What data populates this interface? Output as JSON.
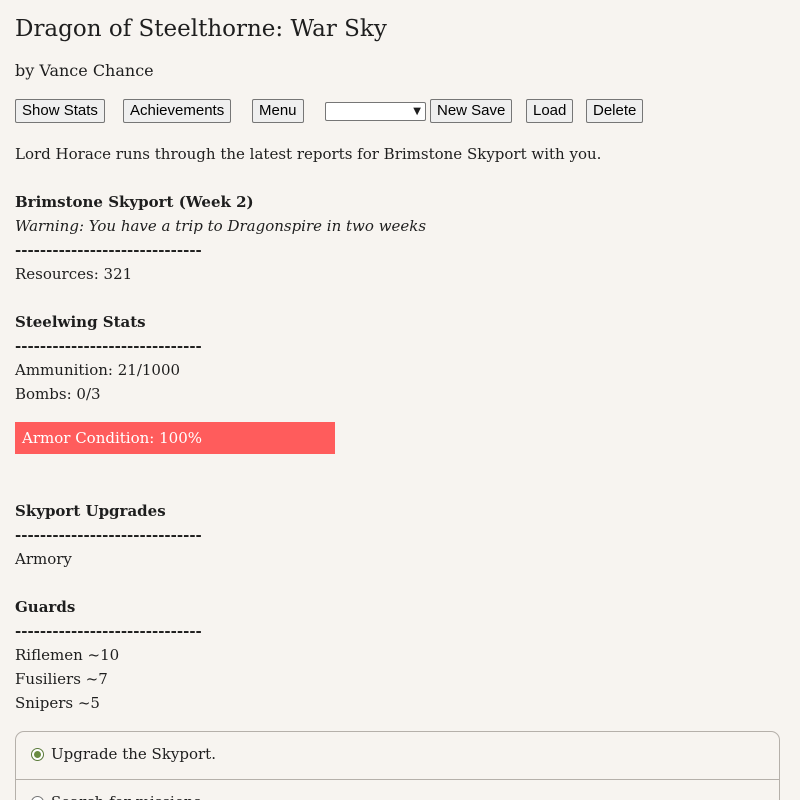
{
  "header": {
    "title": "Dragon of Steelthorne: War Sky",
    "author": "by Vance Chance"
  },
  "toolbar": {
    "show_stats": "Show Stats",
    "achievements": "Achievements",
    "menu": "Menu",
    "save_slot_value": "",
    "new_save": "New Save",
    "load": "Load",
    "delete": "Delete"
  },
  "intro": "Lord Horace runs through the latest reports for Brimstone Skyport with you.",
  "skyport": {
    "heading": "Brimstone Skyport (Week 2)",
    "warning": "Warning: You have a trip to Dragonspire in two weeks",
    "divider": "------------------------------",
    "resources": "Resources: 321"
  },
  "steelwing": {
    "heading": "Steelwing Stats",
    "divider": "------------------------------",
    "ammunition": "Ammunition: 21/1000",
    "bombs": "Bombs: 0/3",
    "armor_label": "Armor Condition: 100%",
    "armor_percent": 100,
    "armor_color": "#ff5c5c"
  },
  "upgrades": {
    "heading": "Skyport Upgrades",
    "divider": "------------------------------",
    "items": [
      "Armory"
    ]
  },
  "guards": {
    "heading": "Guards",
    "divider": "------------------------------",
    "items": [
      "Riflemen ~10",
      "Fusiliers ~7",
      "Snipers ~5"
    ]
  },
  "choices": [
    {
      "label": "Upgrade the Skyport.",
      "selected": true
    },
    {
      "label": "Search for missions.",
      "selected": false
    }
  ]
}
